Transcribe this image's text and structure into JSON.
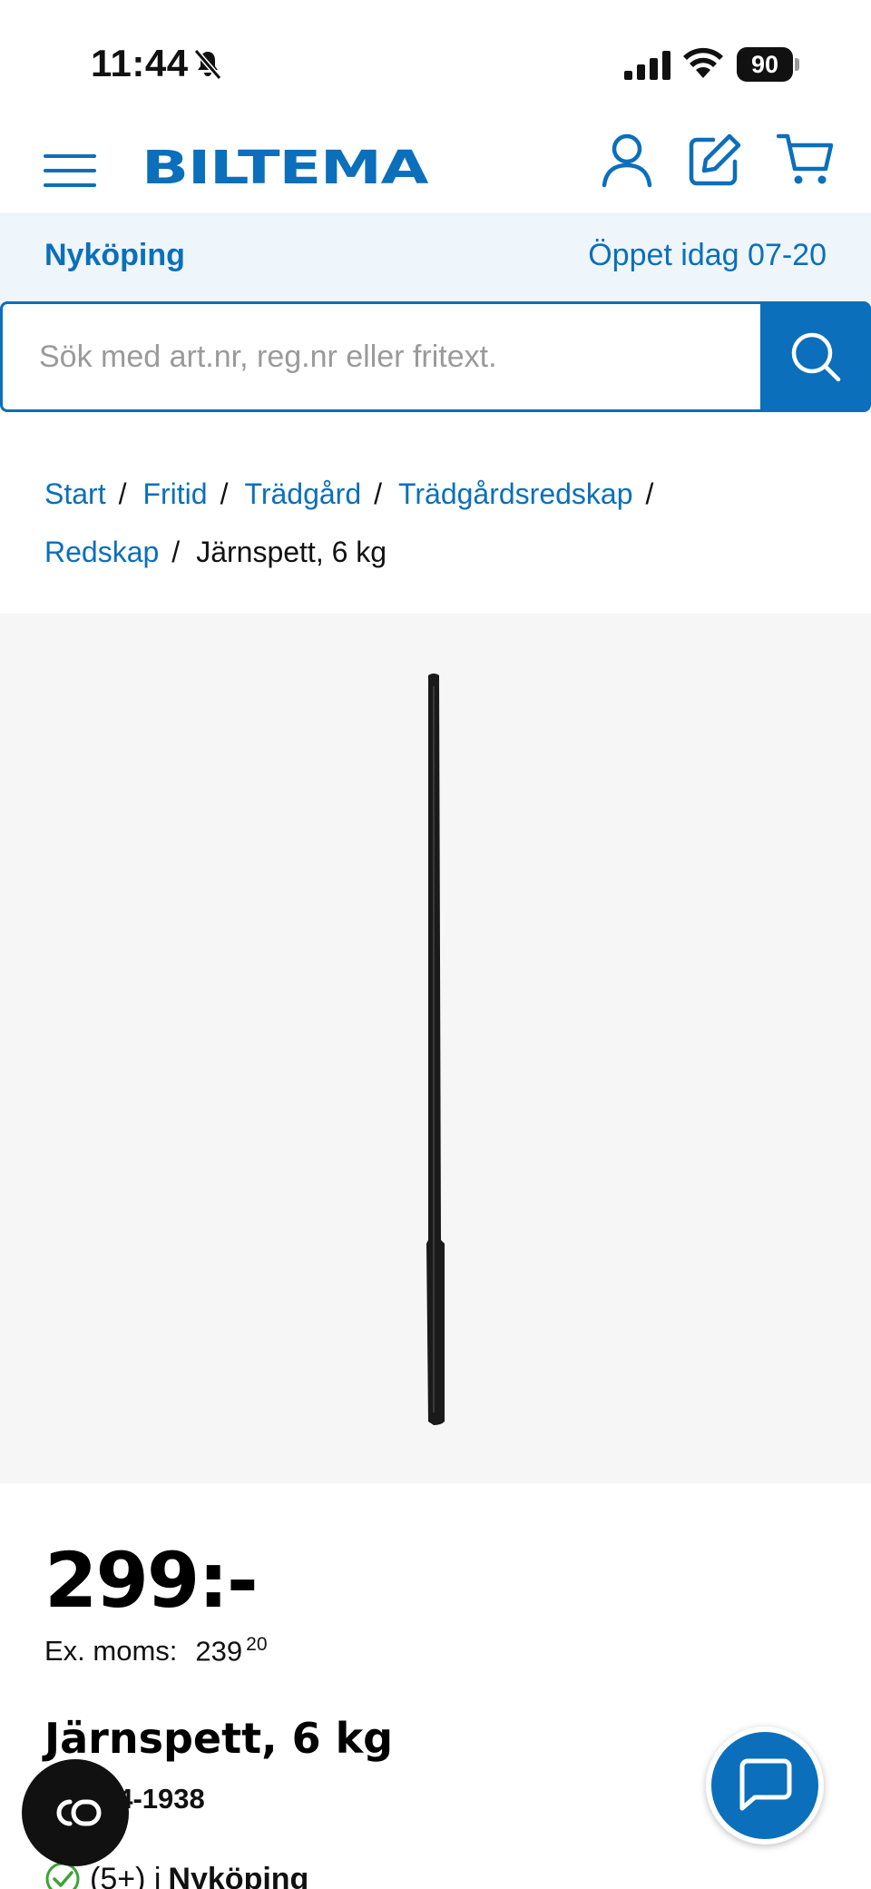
{
  "status_bar": {
    "time": "11:44",
    "battery": "90",
    "icons": [
      "bell-off-icon",
      "signal-icon",
      "wifi-icon",
      "battery-icon"
    ]
  },
  "header": {
    "logo": "BILTEMA",
    "icons": [
      "menu-icon",
      "user-icon",
      "edit-icon",
      "cart-icon"
    ],
    "brand_color": "#0b6fbb"
  },
  "store_bar": {
    "store": "Nyköping",
    "hours": "Öppet idag 07-20"
  },
  "search": {
    "placeholder": "Sök med art.nr, reg.nr eller fritext."
  },
  "breadcrumb": {
    "items": [
      "Start",
      "Fritid",
      "Trädgård",
      "Trädgårdsredskap",
      "Redskap"
    ],
    "current": "Järnspett, 6 kg",
    "separator": "/"
  },
  "product": {
    "price": "299:-",
    "ex_moms_label": "Ex. moms:",
    "ex_moms_int": "239",
    "ex_moms_dec": "20",
    "title": "Järnspett, 6 kg",
    "art_nr": "14-1938",
    "stock_count": "(5+) i",
    "stock_store": "Nyköping"
  },
  "floating": {
    "co_icon": "co-link-icon",
    "chat_icon": "chat-bubble-icon"
  }
}
